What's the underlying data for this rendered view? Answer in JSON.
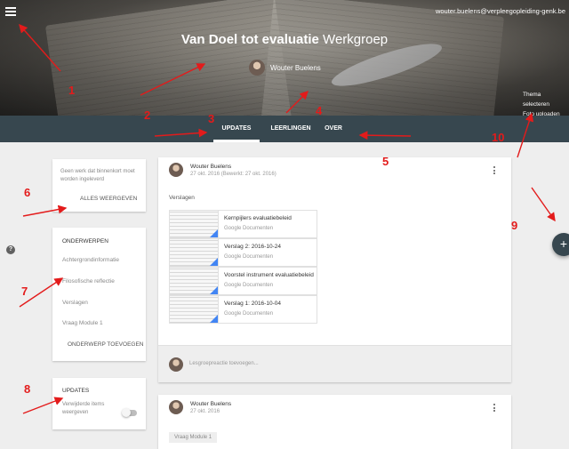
{
  "header": {
    "user_email": "wouter.buelens@verpleegopleiding-genk.be",
    "title_bold": "Van Doel tot evaluatie",
    "title_rest": " Werkgroep",
    "owner_name": "Wouter Buelens",
    "theme_select": "Thema selecteren",
    "photo_upload": "Foto uploaden"
  },
  "tabs": [
    {
      "label": "UPDATES",
      "active": true
    },
    {
      "label": "LEERLINGEN",
      "active": false
    },
    {
      "label": "OVER",
      "active": false
    }
  ],
  "upcoming": {
    "message": "Geen werk dat binnenkort moet worden ingeleverd",
    "button": "ALLES WEERGEVEN"
  },
  "topics": {
    "header": "ONDERWERPEN",
    "items": [
      "Achtergrondinformatie",
      "Filosofische reflectie",
      "Verslagen",
      "Vraag Module 1"
    ],
    "add_button": "ONDERWERP TOEVOEGEN"
  },
  "updates_card": {
    "header": "UPDATES",
    "label": "Verwijderde items weergeven",
    "toggle_on": false
  },
  "posts": [
    {
      "author": "Wouter Buelens",
      "date": "27 okt. 2016 (Bewerkt: 27 okt. 2016)",
      "section": "Verslagen",
      "attachments": [
        {
          "title": "Kernpijlers evaluatiebeleid",
          "type": "Google Documenten"
        },
        {
          "title": "Verslag 2: 2016-10-24",
          "type": "Google Documenten"
        },
        {
          "title": "Voorstel instrument evaluatiebeleid",
          "type": "Google Documenten"
        },
        {
          "title": "Verslag 1: 2016-10-04",
          "type": "Google Documenten"
        }
      ],
      "comment_placeholder": "Lesgroepreactie toevoegen..."
    },
    {
      "author": "Wouter Buelens",
      "date": "27 okt. 2016",
      "topic_chip": "Vraag Module 1"
    }
  ],
  "fab_label": "+",
  "help_label": "?",
  "annotations": [
    "1",
    "2",
    "3",
    "4",
    "5",
    "6",
    "7",
    "8",
    "9",
    "10"
  ],
  "colors": {
    "tabs_bar": "#37474f",
    "annotation": "#e31b1b",
    "fab": "#37474f",
    "doc_accent": "#4285f4"
  }
}
